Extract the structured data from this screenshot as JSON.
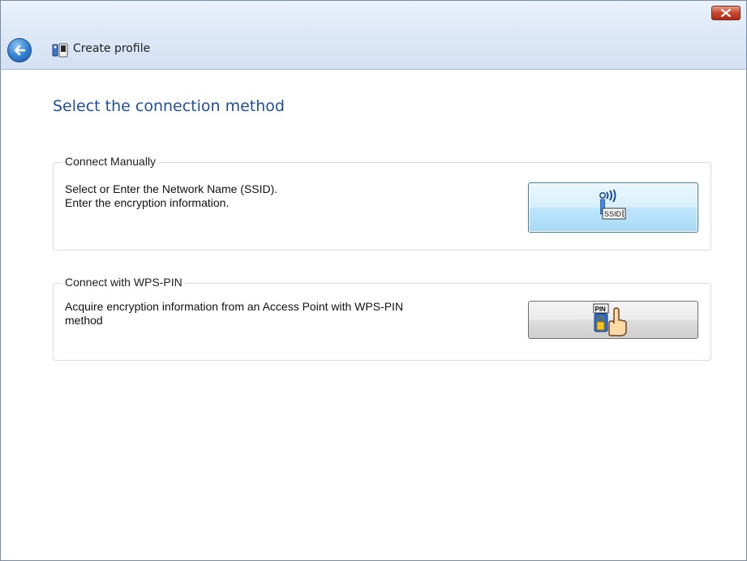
{
  "window": {
    "title": "Create profile"
  },
  "page": {
    "heading": "Select the connection method"
  },
  "groups": [
    {
      "legend": "Connect Manually",
      "lines": [
        "Select or Enter the Network Name (SSID).",
        "Enter the encryption information."
      ],
      "button_icon": "ssid-icon",
      "icon_text": "SSID"
    },
    {
      "legend": "Connect with WPS-PIN",
      "lines": [
        "Acquire encryption information from an Access Point with WPS-PIN",
        "method"
      ],
      "button_icon": "wps-pin-icon",
      "icon_text": "PIN"
    }
  ],
  "colors": {
    "heading": "#1f4fa0",
    "titlebar": "#dce7f6",
    "close": "#c9452d",
    "focused_button": "#bee6fd"
  }
}
